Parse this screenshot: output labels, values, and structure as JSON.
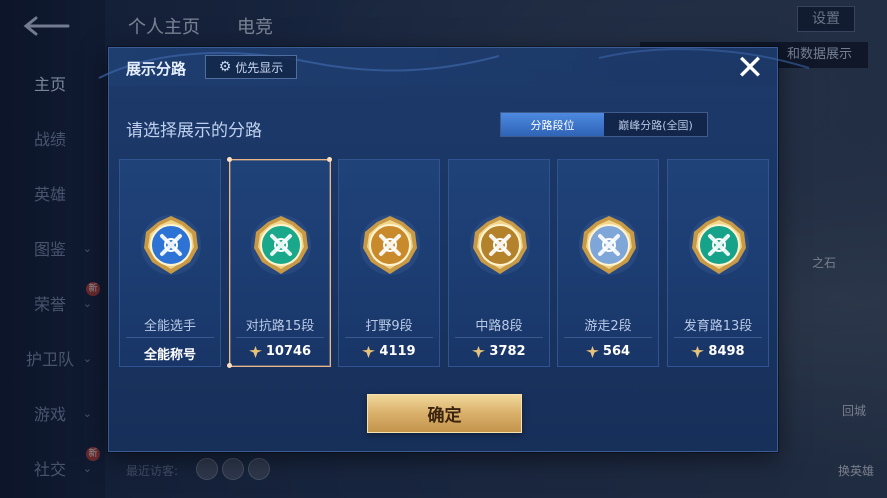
{
  "side_nav": {
    "items": [
      {
        "label": "主页",
        "active": true,
        "chevron": false,
        "new": false
      },
      {
        "label": "战绩",
        "active": false,
        "chevron": false,
        "new": false
      },
      {
        "label": "英雄",
        "active": false,
        "chevron": false,
        "new": false
      },
      {
        "label": "图鉴",
        "active": false,
        "chevron": true,
        "new": false
      },
      {
        "label": "荣誉",
        "active": false,
        "chevron": true,
        "new": true
      },
      {
        "label": "护卫队",
        "active": false,
        "chevron": true,
        "new": false
      },
      {
        "label": "游戏",
        "active": false,
        "chevron": true,
        "new": false
      },
      {
        "label": "社交",
        "active": false,
        "chevron": true,
        "new": true
      }
    ],
    "new_badge": "新"
  },
  "top_tabs": [
    "个人主页",
    "电竞"
  ],
  "top_right": {
    "settings": "设置",
    "data_display": "和数据展示"
  },
  "recent_visitors": "最近访客:",
  "right_side": {
    "stone": "之石",
    "guard": "回城",
    "swap_hero": "换英雄"
  },
  "modal": {
    "title": "展示分路",
    "priority_button": "优先显示",
    "subtitle": "请选择展示的分路",
    "segments": [
      {
        "label": "分路段位",
        "active": true
      },
      {
        "label": "巅峰分路(全国)",
        "active": false
      }
    ],
    "cards": [
      {
        "name": "全能选手",
        "value": "全能称号",
        "show_icon": false,
        "selected": false,
        "icon": "allround-emblem-icon",
        "color": "#2d73d6"
      },
      {
        "name": "对抗路15段",
        "value": "10746",
        "show_icon": true,
        "selected": true,
        "icon": "clash-lane-emblem-icon",
        "color": "#19a88a"
      },
      {
        "name": "打野9段",
        "value": "4119",
        "show_icon": true,
        "selected": false,
        "icon": "jungle-emblem-icon",
        "color": "#c98a2c"
      },
      {
        "name": "中路8段",
        "value": "3782",
        "show_icon": true,
        "selected": false,
        "icon": "mid-lane-emblem-icon",
        "color": "#b5822c"
      },
      {
        "name": "游走2段",
        "value": "564",
        "show_icon": true,
        "selected": false,
        "icon": "roam-emblem-icon",
        "color": "#7ea6d8"
      },
      {
        "name": "发育路13段",
        "value": "8498",
        "show_icon": true,
        "selected": false,
        "icon": "farm-lane-emblem-icon",
        "color": "#17a38a"
      }
    ],
    "confirm_button": "确定",
    "close_icon": "close-icon"
  },
  "colors": {
    "modal_bg": "#1d3a6c",
    "gold_button": "#d9b06a",
    "selected_border": "#e9b78b",
    "segment_active": "#3c73c8"
  }
}
